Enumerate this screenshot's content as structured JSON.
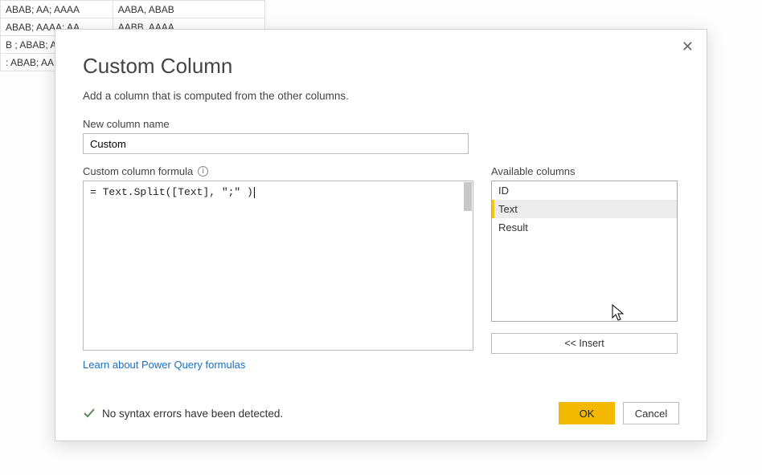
{
  "background_rows": [
    [
      "ABAB; AA; AAAA",
      "AABA, ABAB"
    ],
    [
      "ABAB; AAAA: AA",
      "AABB. AAAA"
    ],
    [
      "B ; ABAB; A",
      ""
    ],
    [
      ": ABAB; AA;",
      ""
    ]
  ],
  "dialog": {
    "title": "Custom Column",
    "subtitle": "Add a column that is computed from the other columns.",
    "name_label": "New column name",
    "name_value": "Custom",
    "formula_label": "Custom column formula",
    "formula_text": "= Text.Split([Text], \";\" )",
    "avail_label": "Available columns",
    "avail_items": [
      "ID",
      "Text",
      "Result"
    ],
    "avail_selected_index": 1,
    "insert_label": "<< Insert",
    "learn_link": "Learn about Power Query formulas",
    "status_text": "No syntax errors have been detected.",
    "ok_label": "OK",
    "cancel_label": "Cancel"
  }
}
